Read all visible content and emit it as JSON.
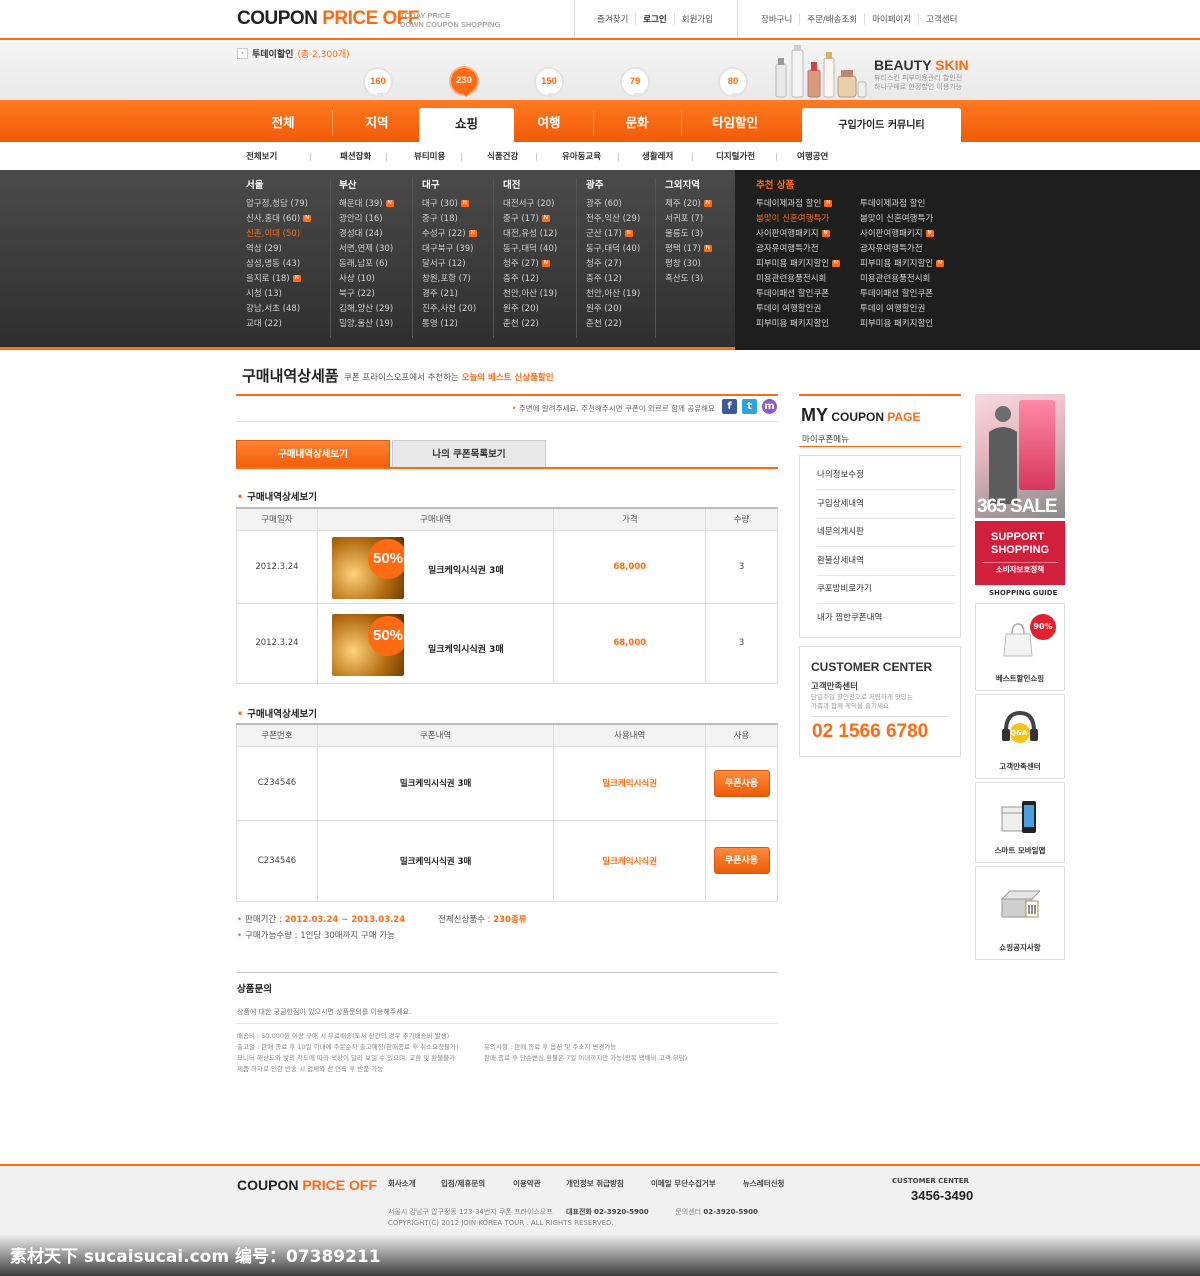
{
  "header": {
    "logo_main": "COUPON ",
    "logo_accent": "PRICE OFF",
    "logo_sub1": "TODAY PRICE",
    "logo_sub2": "DOWN COUPON SHOPPING",
    "links_left": [
      "즐겨찾기",
      "로그인",
      "회원가입"
    ],
    "links_right": [
      "장바구니",
      "주문/배송조회",
      "마이페이지",
      "고객센터"
    ]
  },
  "band": {
    "today_label": "투데이할인",
    "today_count": "(총 2,300개)",
    "bubbles": [
      "160",
      "230",
      "150",
      "79",
      "80"
    ],
    "beauty_title": "BEAUTY ",
    "beauty_accent": "SKIN",
    "beauty_sub1": "뷰티스킨 피부미용관리 할인전",
    "beauty_sub2": "하나구매로 한정할인 이용가능"
  },
  "nav": {
    "items": [
      "전체",
      "지역",
      "쇼핑",
      "여행",
      "문화",
      "타임할인"
    ],
    "active": "쇼핑",
    "guide": "구입가이드 커뮤니티"
  },
  "subnav": [
    "전체보기",
    "패션잡화",
    "뷰티미용",
    "식품건강",
    "유아동교육",
    "생활레저",
    "디지털가전",
    "여행공연"
  ],
  "regions": [
    {
      "title": "서울",
      "items": [
        "압구정,청담 (79)",
        "신사,홍대 (60)",
        "신촌,이대 (50)",
        "역삼 (29)",
        "삼성,명동 (43)",
        "을지로 (18)",
        "시청 (13)",
        "강남,서초 (48)",
        "교대 (22)"
      ]
    },
    {
      "title": "부산",
      "items": [
        "해운대 (39)",
        "광안리 (16)",
        "경성대 (24)",
        "서면,연제 (30)",
        "동래,남포 (6)",
        "사상 (10)",
        "북구 (22)",
        "김해,양산 (29)",
        "밀양,울산 (19)"
      ]
    },
    {
      "title": "대구",
      "items": [
        "대구 (30)",
        "중구 (18)",
        "수성구 (22)",
        "대구북구 (39)",
        "달서구 (12)",
        "창원,포항 (7)",
        "경주 (21)",
        "진주,사천 (20)",
        "통영 (12)"
      ]
    },
    {
      "title": "대전",
      "items": [
        "대전서구 (20)",
        "중구 (17)",
        "대전,유성 (12)",
        "동구,대덕 (40)",
        "청주 (27)",
        "충주 (12)",
        "천안,아산 (19)",
        "원주 (20)",
        "춘천 (22)"
      ]
    },
    {
      "title": "광주",
      "items": [
        "광주 (60)",
        "전주,익산 (29)",
        "군산 (17)",
        "동구,대덕 (40)",
        "청주 (27)",
        "충주 (12)",
        "천안,아산 (19)",
        "원주 (20)",
        "춘천 (22)"
      ]
    },
    {
      "title": "그외지역",
      "items": [
        "제주 (20)",
        "서귀포 (7)",
        "울릉도 (3)",
        "평택 (17)",
        "평창 (30)",
        "흑산도 (3)"
      ]
    }
  ],
  "recommend": {
    "title": "추천 상품",
    "col1": [
      "투데이제과점 할인",
      "봄맞이 신혼여행특가",
      "사이판여행패키지",
      "괌자유여행특가전",
      "피부미용 패키지할인",
      "미용관련용품전시회",
      "투데이패션 할인쿠폰",
      "투데이 여행할인권",
      "피부미용 패키지할인"
    ],
    "col2": [
      "투데이제과점 할인",
      "봄맞이 신혼여행특가",
      "사이판여행패키지",
      "괌자유여행특가전",
      "피부미용 패키지할인",
      "미용관련용품전시회",
      "투데이패션 할인쿠폰",
      "투데이 여행할인권",
      "피부미용 패키지할인"
    ]
  },
  "page": {
    "title": "구매내역상세품",
    "desc_pre": "쿠폰 프라이스오프에서 추천하는 ",
    "desc_accent": "오늘의 베스트 신상품할인",
    "share": "주변에 알려주세요. 추천해주시면 쿠폰이 와르르 함께 공유해요",
    "share_icons": [
      "f",
      "t",
      "m"
    ],
    "tab_on": "구매내역상세보기",
    "tab_off": "나의 쿠폰목록보기",
    "sec1": "구매내역상세보기",
    "sec2": "구매내역상세보기"
  },
  "purchase_table": {
    "headers": [
      "구매일자",
      "구매내역",
      "가격",
      "수량"
    ],
    "rows": [
      {
        "date": "2012.3.24",
        "badge": "50%",
        "name": "밀크케익시식권 3매",
        "price": "68,000",
        "qty": "3"
      },
      {
        "date": "2012.3.24",
        "badge": "50%",
        "name": "밀크케익시식권 3매",
        "price": "68,000",
        "qty": "3"
      }
    ]
  },
  "coupon_table": {
    "headers": [
      "쿠폰번호",
      "쿠폰내역",
      "사용내역",
      "사용"
    ],
    "rows": [
      {
        "no": "C234546",
        "name": "밀크케익시식권 3매",
        "usage": "밀크케익시식권",
        "btn": "쿠폰사용"
      },
      {
        "no": "C234546",
        "name": "밀크케익시식권 3매",
        "usage": "밀크케익시식권",
        "btn": "쿠폰사용"
      }
    ]
  },
  "info": {
    "period_label": "판매기간 : ",
    "period": "2012.03.24 ~ 2013.03.24",
    "total_label": "전체신상품수 : ",
    "total": "230종류",
    "limit": "구매가능수량 : 1인당 30매까지 구매 가능"
  },
  "inquiry": {
    "title": "상품문의",
    "desc": "상품에 대한 궁금한점이 있으시면 상품문의를 이용해주세요.",
    "notes_left": [
      "배송비 : 50,000원 이상 구매 시 무료배송(도서 산간의 경우 추가배송비 발생)",
      "출고일 : 판매 종료 후 10일 이내에 주문순차 출고예정(판매종료 후 취소요청불가)",
      "모니터 해상도와 빛의 각도에 따라 색상이 달라 보일 수 있으며, 교환 및 환불불가",
      "제품 하자로 인한 반송 시 업체와 선 연락 후 반품 가능"
    ],
    "notes_right": [
      "유의사항 : 판매 종료 후 옵션 및 주소지 변경가능",
      "판매 종료 후 단순변심 환불은 7일 이내까지만 가능(왕복 택배비 고객 부담)"
    ]
  },
  "sidebar": {
    "my_big": "MY",
    "my_mid": " COUPON ",
    "my_accent": "PAGE",
    "my_sub": "마이쿠폰메뉴",
    "menu": [
      "나의정보수정",
      "구입상세내역",
      "네문의게시판",
      "환불상세내역",
      "쿠포방비로가기",
      "내가 찜한쿠폰내역"
    ],
    "cc_title": "CUSTOMER CENTER",
    "cc_sub": "고객만족센터",
    "cc_desc1": "단일주일 할인전으로 저렴하게 맛있는",
    "cc_desc2": "가족과 함께 케익을 즐기세요",
    "cc_phone": "02 1566 6780"
  },
  "banners": {
    "sale": "365 SALE",
    "support1": "SUPPORT",
    "support2": "SHOPPING",
    "support_sub": "소비자보호정책",
    "guide_title": "SHOPPING GUIDE",
    "guide_items": [
      "베스트할인쇼핑",
      "고객만족센터",
      "스마트 모바일앱",
      "쇼핑공지사항"
    ],
    "badge_90": "90%",
    "qa": "Q&A"
  },
  "footer": {
    "logo_main": "COUPON ",
    "logo_accent": "PRICE OFF",
    "links": [
      "회사소개",
      "입점/제휴문의",
      "이용약관",
      "개인정보 취급방침",
      "이메일 무단수집거부",
      "뉴스레터신청"
    ],
    "addr": "서울시 강남구 압구정동 123-34번지  쿠폰 프라이스오프",
    "tel_label": "대표전화",
    "tel": "02-3920-5900",
    "cs_label": "문의센터",
    "cs_tel": "02-3920-5900",
    "copyright": "COPYRIGHT(C) 2012 JOIN KOREA TOUR . ALL RIGHTS RESERVED.",
    "cc_title": "CUSTOMER CENTER",
    "cc_phone": "3456-3490"
  },
  "watermark": "素材天下 sucaisucai.com  编号：07389211",
  "colors": {
    "accent": "#ff6a13",
    "dark_panel": "#2f2f2f",
    "red_banner": "#d21f3c"
  }
}
